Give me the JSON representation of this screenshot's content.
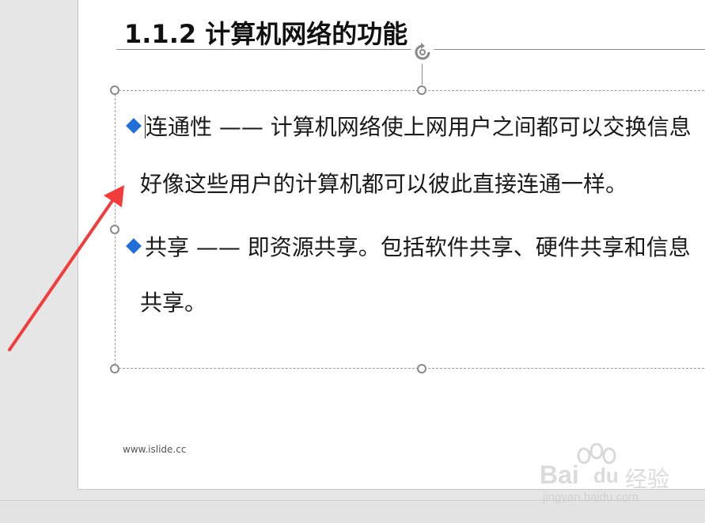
{
  "slide": {
    "title": "1.1.2 计算机网络的功能",
    "bullets": [
      {
        "line1": "连通性 —— 计算机网络使上网用户之间都可以交换信息",
        "line2": "好像这些用户的计算机都可以彼此直接连通一样。"
      },
      {
        "line1": "共享 —— 即资源共享。包括软件共享、硬件共享和信息",
        "line2": "共享。"
      }
    ],
    "footer_url": "www.islide.cc"
  },
  "watermark": {
    "brand_left": "Bai",
    "brand_right": "du",
    "brand_cn": "经验",
    "site": "jingyan.baidu.com"
  },
  "colors": {
    "bullet": "#1f6fd6",
    "annotation_arrow": "#f03c3c",
    "handle": "#8a8a8a"
  },
  "icons": {
    "rotate": "rotate-handle-icon",
    "bullet": "blue-diamond-bullet-icon",
    "arrow": "red-annotation-arrow"
  }
}
